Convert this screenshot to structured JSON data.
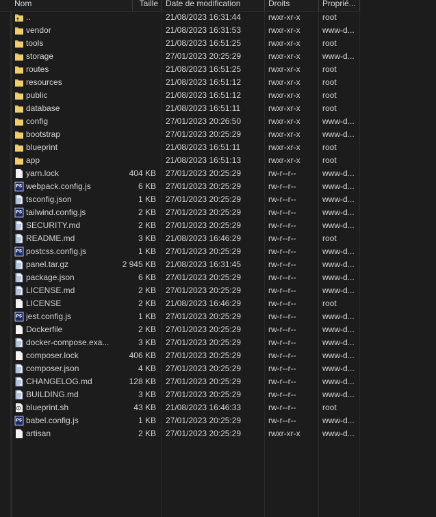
{
  "columns": {
    "name": "Nom",
    "size": "Taille",
    "date": "Date de modification",
    "perm": "Droits",
    "owner": "Proprié..."
  },
  "files": [
    {
      "name": "..",
      "size": "",
      "date": "21/08/2023 16:31:44",
      "perm": "rwxr-xr-x",
      "owner": "root",
      "icon": "parent-folder-icon"
    },
    {
      "name": "vendor",
      "size": "",
      "date": "21/08/2023 16:31:53",
      "perm": "rwxr-xr-x",
      "owner": "www-d...",
      "icon": "folder-icon"
    },
    {
      "name": "tools",
      "size": "",
      "date": "21/08/2023 16:51:25",
      "perm": "rwxr-xr-x",
      "owner": "root",
      "icon": "folder-icon"
    },
    {
      "name": "storage",
      "size": "",
      "date": "27/01/2023 20:25:29",
      "perm": "rwxr-xr-x",
      "owner": "www-d...",
      "icon": "folder-icon"
    },
    {
      "name": "routes",
      "size": "",
      "date": "21/08/2023 16:51:25",
      "perm": "rwxr-xr-x",
      "owner": "root",
      "icon": "folder-icon"
    },
    {
      "name": "resources",
      "size": "",
      "date": "21/08/2023 16:51:12",
      "perm": "rwxr-xr-x",
      "owner": "root",
      "icon": "folder-icon"
    },
    {
      "name": "public",
      "size": "",
      "date": "21/08/2023 16:51:12",
      "perm": "rwxr-xr-x",
      "owner": "root",
      "icon": "folder-icon"
    },
    {
      "name": "database",
      "size": "",
      "date": "21/08/2023 16:51:11",
      "perm": "rwxr-xr-x",
      "owner": "root",
      "icon": "folder-icon"
    },
    {
      "name": "config",
      "size": "",
      "date": "27/01/2023 20:26:50",
      "perm": "rwxr-xr-x",
      "owner": "www-d...",
      "icon": "folder-icon"
    },
    {
      "name": "bootstrap",
      "size": "",
      "date": "27/01/2023 20:25:29",
      "perm": "rwxr-xr-x",
      "owner": "www-d...",
      "icon": "folder-icon"
    },
    {
      "name": "blueprint",
      "size": "",
      "date": "21/08/2023 16:51:11",
      "perm": "rwxr-xr-x",
      "owner": "root",
      "icon": "folder-icon"
    },
    {
      "name": "app",
      "size": "",
      "date": "21/08/2023 16:51:13",
      "perm": "rwxr-xr-x",
      "owner": "root",
      "icon": "folder-icon"
    },
    {
      "name": "yarn.lock",
      "size": "404 KB",
      "date": "27/01/2023 20:25:29",
      "perm": "rw-r--r--",
      "owner": "www-d...",
      "icon": "file-icon"
    },
    {
      "name": "webpack.config.js",
      "size": "6 KB",
      "date": "27/01/2023 20:25:29",
      "perm": "rw-r--r--",
      "owner": "www-d...",
      "icon": "powershell-icon"
    },
    {
      "name": "tsconfig.json",
      "size": "1 KB",
      "date": "27/01/2023 20:25:29",
      "perm": "rw-r--r--",
      "owner": "www-d...",
      "icon": "text-file-icon"
    },
    {
      "name": "tailwind.config.js",
      "size": "2 KB",
      "date": "27/01/2023 20:25:29",
      "perm": "rw-r--r--",
      "owner": "www-d...",
      "icon": "powershell-icon"
    },
    {
      "name": "SECURITY.md",
      "size": "2 KB",
      "date": "27/01/2023 20:25:29",
      "perm": "rw-r--r--",
      "owner": "www-d...",
      "icon": "text-file-icon"
    },
    {
      "name": "README.md",
      "size": "3 KB",
      "date": "21/08/2023 16:46:29",
      "perm": "rw-r--r--",
      "owner": "root",
      "icon": "text-file-icon"
    },
    {
      "name": "postcss.config.js",
      "size": "1 KB",
      "date": "27/01/2023 20:25:29",
      "perm": "rw-r--r--",
      "owner": "www-d...",
      "icon": "powershell-icon"
    },
    {
      "name": "panel.tar.gz",
      "size": "2 945 KB",
      "date": "21/08/2023 16:31:45",
      "perm": "rw-r--r--",
      "owner": "www-d...",
      "icon": "text-file-icon"
    },
    {
      "name": "package.json",
      "size": "6 KB",
      "date": "27/01/2023 20:25:29",
      "perm": "rw-r--r--",
      "owner": "www-d...",
      "icon": "text-file-icon"
    },
    {
      "name": "LICENSE.md",
      "size": "2 KB",
      "date": "27/01/2023 20:25:29",
      "perm": "rw-r--r--",
      "owner": "www-d...",
      "icon": "text-file-icon"
    },
    {
      "name": "LICENSE",
      "size": "2 KB",
      "date": "21/08/2023 16:46:29",
      "perm": "rw-r--r--",
      "owner": "root",
      "icon": "file-icon"
    },
    {
      "name": "jest.config.js",
      "size": "1 KB",
      "date": "27/01/2023 20:25:29",
      "perm": "rw-r--r--",
      "owner": "www-d...",
      "icon": "powershell-icon"
    },
    {
      "name": "Dockerfile",
      "size": "2 KB",
      "date": "27/01/2023 20:25:29",
      "perm": "rw-r--r--",
      "owner": "www-d...",
      "icon": "file-icon"
    },
    {
      "name": "docker-compose.exa...",
      "size": "3 KB",
      "date": "27/01/2023 20:25:29",
      "perm": "rw-r--r--",
      "owner": "www-d...",
      "icon": "text-file-icon"
    },
    {
      "name": "composer.lock",
      "size": "406 KB",
      "date": "27/01/2023 20:25:29",
      "perm": "rw-r--r--",
      "owner": "www-d...",
      "icon": "file-icon"
    },
    {
      "name": "composer.json",
      "size": "4 KB",
      "date": "27/01/2023 20:25:29",
      "perm": "rw-r--r--",
      "owner": "www-d...",
      "icon": "text-file-icon"
    },
    {
      "name": "CHANGELOG.md",
      "size": "128 KB",
      "date": "27/01/2023 20:25:29",
      "perm": "rw-r--r--",
      "owner": "www-d...",
      "icon": "text-file-icon"
    },
    {
      "name": "BUILDING.md",
      "size": "3 KB",
      "date": "27/01/2023 20:25:29",
      "perm": "rw-r--r--",
      "owner": "www-d...",
      "icon": "text-file-icon"
    },
    {
      "name": "blueprint.sh",
      "size": "43 KB",
      "date": "21/08/2023 16:46:33",
      "perm": "rw-r--r--",
      "owner": "root",
      "icon": "script-file-icon"
    },
    {
      "name": "babel.config.js",
      "size": "1 KB",
      "date": "27/01/2023 20:25:29",
      "perm": "rw-r--r--",
      "owner": "www-d...",
      "icon": "powershell-icon"
    },
    {
      "name": "artisan",
      "size": "2 KB",
      "date": "27/01/2023 20:25:29",
      "perm": "rwxr-xr-x",
      "owner": "www-d...",
      "icon": "file-icon"
    }
  ],
  "colors": {
    "background": "#1c1c1c",
    "folder": "#e8c25a",
    "text": "#d4d4d4"
  }
}
